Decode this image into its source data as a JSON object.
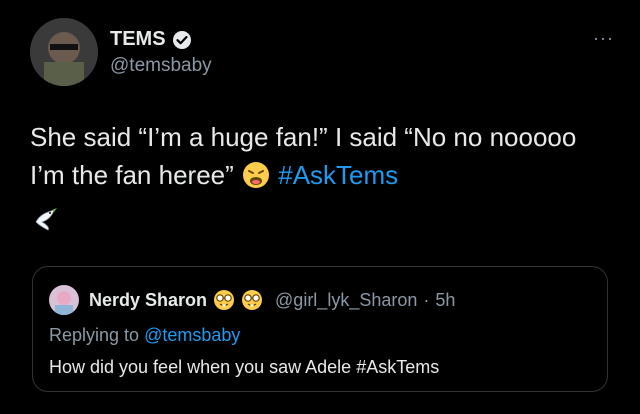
{
  "author": {
    "display_name": "TEMS",
    "handle": "@temsbaby",
    "verified_icon": "verified-badge-icon",
    "more_label": "···"
  },
  "tweet": {
    "text_part1": "She said “I’m a huge fan!” I said “No no nooooo I’m the fan heree”",
    "emoji_1": "weary-face-emoji",
    "hashtag": "#AskTems",
    "emoji_2": "dove-emoji"
  },
  "quoted": {
    "display_name": "Nerdy Sharon",
    "emojis": [
      "nerd-face-emoji",
      "nerd-face-emoji"
    ],
    "handle": "@girl_lyk_Sharon",
    "separator": "·",
    "time": "5h",
    "replying_prefix": "Replying to",
    "replying_to": "@temsbaby",
    "text": "How did you feel when you saw Adele",
    "hashtag": "#AskTems"
  },
  "colors": {
    "background": "#000000",
    "text": "#e7e9ea",
    "secondary": "#8b98a5",
    "link": "#1d9bf0",
    "border": "#2f3336"
  }
}
